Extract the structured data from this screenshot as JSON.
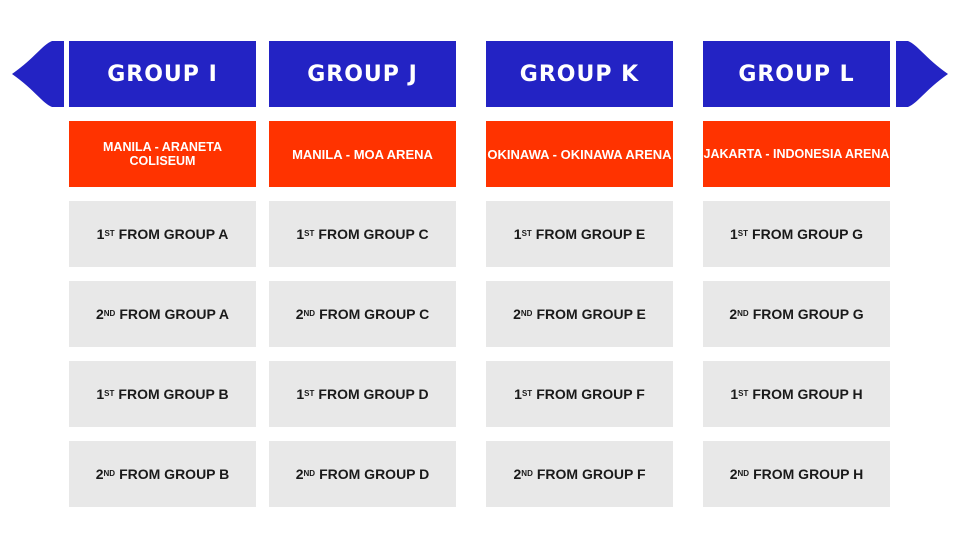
{
  "colors": {
    "header": "#2323c4",
    "venue": "#ff3300",
    "cell": "#e8e8e8",
    "text_dark": "#1a1a1a"
  },
  "groups": [
    {
      "title": "GROUP I",
      "venue": "MANILA - ARANETA COLISEUM",
      "slots": [
        {
          "ord": "1",
          "suf": "ST",
          "text": "FROM GROUP A"
        },
        {
          "ord": "2",
          "suf": "ND",
          "text": "FROM GROUP A"
        },
        {
          "ord": "1",
          "suf": "ST",
          "text": "FROM GROUP B"
        },
        {
          "ord": "2",
          "suf": "ND",
          "text": "FROM GROUP B"
        }
      ]
    },
    {
      "title": "GROUP J",
      "venue": "MANILA - MOA ARENA",
      "slots": [
        {
          "ord": "1",
          "suf": "ST",
          "text": "FROM GROUP C"
        },
        {
          "ord": "2",
          "suf": "ND",
          "text": "FROM GROUP C"
        },
        {
          "ord": "1",
          "suf": "ST",
          "text": "FROM GROUP D"
        },
        {
          "ord": "2",
          "suf": "ND",
          "text": "FROM GROUP D"
        }
      ]
    },
    {
      "title": "GROUP K",
      "venue": "OKINAWA - OKINAWA ARENA",
      "slots": [
        {
          "ord": "1",
          "suf": "ST",
          "text": "FROM GROUP E"
        },
        {
          "ord": "2",
          "suf": "ND",
          "text": "FROM GROUP E"
        },
        {
          "ord": "1",
          "suf": "ST",
          "text": "FROM GROUP F"
        },
        {
          "ord": "2",
          "suf": "ND",
          "text": "FROM GROUP F"
        }
      ]
    },
    {
      "title": "GROUP L",
      "venue": "JAKARTA - INDONESIA ARENA",
      "slots": [
        {
          "ord": "1",
          "suf": "ST",
          "text": "FROM GROUP G"
        },
        {
          "ord": "2",
          "suf": "ND",
          "text": "FROM GROUP G"
        },
        {
          "ord": "1",
          "suf": "ST",
          "text": "FROM GROUP H"
        },
        {
          "ord": "2",
          "suf": "ND",
          "text": "FROM GROUP H"
        }
      ]
    }
  ]
}
